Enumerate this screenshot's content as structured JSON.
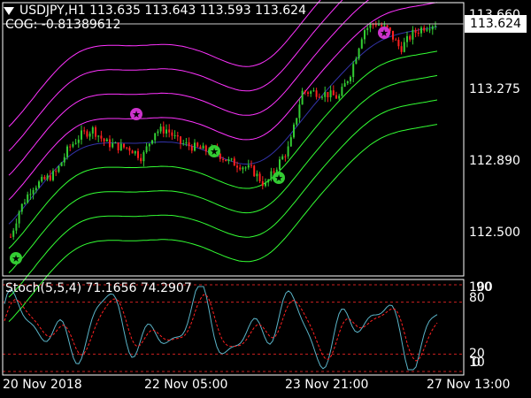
{
  "header": {
    "symbol_line": "USDJPY,H1  113.635 113.643 113.593 113.624",
    "indicator_line": "COG: -0.81389612"
  },
  "price_axis": {
    "labels": [
      "113.660",
      "113.275",
      "112.890",
      "112.500"
    ],
    "current_price": "113.624"
  },
  "oscillator": {
    "label": "Stoch(5,5,4) 71.1656 74.2907",
    "levels": [
      "100",
      "80",
      "20",
      "0"
    ],
    "overlay_levels": [
      "90",
      "10"
    ]
  },
  "time_axis": {
    "labels": [
      "20 Nov 2018",
      "22 Nov 05:00",
      "23 Nov 21:00",
      "27 Nov 13:00"
    ]
  },
  "colors": {
    "background": "#000000",
    "upper_bands": "#ff33ff",
    "lower_bands": "#33ff33",
    "center_line": "#3333aa",
    "bull_candle": "#33cc33",
    "bear_candle": "#ff2020",
    "stoch_main": "#5ab4c8",
    "stoch_signal": "#ff2020",
    "grid_dash": "#cc2020",
    "signal_buy": "#33cc33",
    "signal_sell": "#cc33cc"
  },
  "chart_data": {
    "type": "line",
    "title": "USDJPY,H1",
    "ylim": [
      112.3,
      113.68
    ],
    "series": [
      {
        "values": [
          112.42,
          112.62,
          112.74,
          112.78,
          112.82,
          112.95,
          113.02,
          113.05,
          112.98,
          112.96,
          112.95,
          112.9,
          113.04,
          113.05,
          112.98,
          112.96,
          112.94,
          112.93,
          112.88,
          112.86,
          112.83,
          112.75,
          112.86,
          112.96,
          113.25,
          113.25,
          113.24,
          113.22,
          113.36,
          113.58,
          113.62,
          113.58,
          113.48,
          113.56,
          113.6,
          113.62
        ]
      }
    ]
  }
}
